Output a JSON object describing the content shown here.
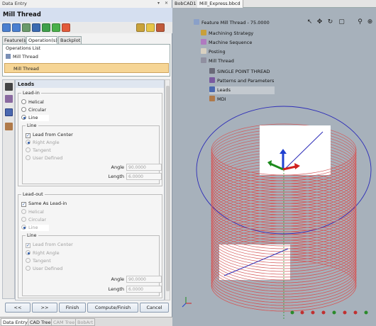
{
  "window": {
    "panel_title": "Data Entry",
    "operation_name": "Mill Thread"
  },
  "tabs": [
    {
      "label": "Feature(s)"
    },
    {
      "label": "Operation(s)"
    },
    {
      "label": "Backplot"
    }
  ],
  "operations_list": {
    "title": "Operations List",
    "items": [
      {
        "label": "Mill Thread"
      },
      {
        "label": "Mill Thread"
      }
    ]
  },
  "leads": {
    "header": "Leads",
    "lead_in": {
      "title": "Lead-in",
      "options": [
        {
          "label": "Helical",
          "selected": false
        },
        {
          "label": "Circular",
          "selected": false
        },
        {
          "label": "Line",
          "selected": true
        }
      ],
      "line_group": {
        "title": "Line",
        "lead_from_center": {
          "label": "Lead from Center",
          "checked": true
        },
        "options": [
          {
            "label": "Right Angle",
            "selected": true
          },
          {
            "label": "Tangent",
            "selected": false
          },
          {
            "label": "User Defined",
            "selected": false
          }
        ],
        "angle": {
          "label": "Angle",
          "value": "90.0000"
        },
        "length": {
          "label": "Length",
          "value": "6.0000"
        }
      }
    },
    "lead_out": {
      "title": "Lead-out",
      "same_as_lead_in": {
        "label": "Same As Lead-in",
        "checked": true
      },
      "options": [
        {
          "label": "Helical",
          "selected": false
        },
        {
          "label": "Circular",
          "selected": false
        },
        {
          "label": "Line",
          "selected": true
        }
      ],
      "line_group": {
        "title": "Line",
        "lead_from_center": {
          "label": "Lead from Center",
          "checked": true
        },
        "options": [
          {
            "label": "Right Angle",
            "selected": true
          },
          {
            "label": "Tangent",
            "selected": false
          },
          {
            "label": "User Defined",
            "selected": false
          }
        ],
        "angle": {
          "label": "Angle",
          "value": "90.0000"
        },
        "length": {
          "label": "Length",
          "value": "6.0000"
        }
      }
    }
  },
  "buttons": {
    "prev": "<<",
    "next": ">>",
    "finish": "Finish",
    "compute_finish": "Compute/Finish",
    "cancel": "Cancel"
  },
  "bottom_tabs": [
    {
      "label": "Data Entry"
    },
    {
      "label": "CAD Tree"
    },
    {
      "label": "CAM Tree"
    },
    {
      "label": "BobArt"
    }
  ],
  "cad_tabs": [
    {
      "label": "BobCAD1"
    },
    {
      "label": "Mill_Express.bbcd"
    }
  ],
  "tree": {
    "feature": "Feature Mill Thread - 75.0000",
    "machining_strategy": "Machining Strategy",
    "machine_sequence": "Machine Sequence",
    "posting": "Posting",
    "op_mill_thread": "Mill Thread",
    "single_point_thread": "SINGLE POINT THREAD",
    "patterns_parameters": "Patterns and Parameters",
    "leads": "Leads",
    "mdi": "MDI"
  },
  "colors": {
    "thread": "#d45a5a",
    "circle": "#2d2db8",
    "selection_tree": "#c3c9cf",
    "header_bg": "#d5dff0",
    "selected_op": "#f6d595"
  },
  "icons": {
    "toolbar": [
      "arrow-left-icon",
      "arrow-right-icon",
      "save-icon",
      "move-down-icon",
      "refresh-icon",
      "checkmark-icon",
      "copy-icon",
      "delete-icon",
      "undo-icon",
      "view-icon",
      "exit-icon"
    ],
    "view_toolbar": [
      "cursor-icon",
      "move-icon",
      "rotate-icon",
      "zoom-box-icon",
      "zoom-icon",
      "fit-icon"
    ]
  }
}
